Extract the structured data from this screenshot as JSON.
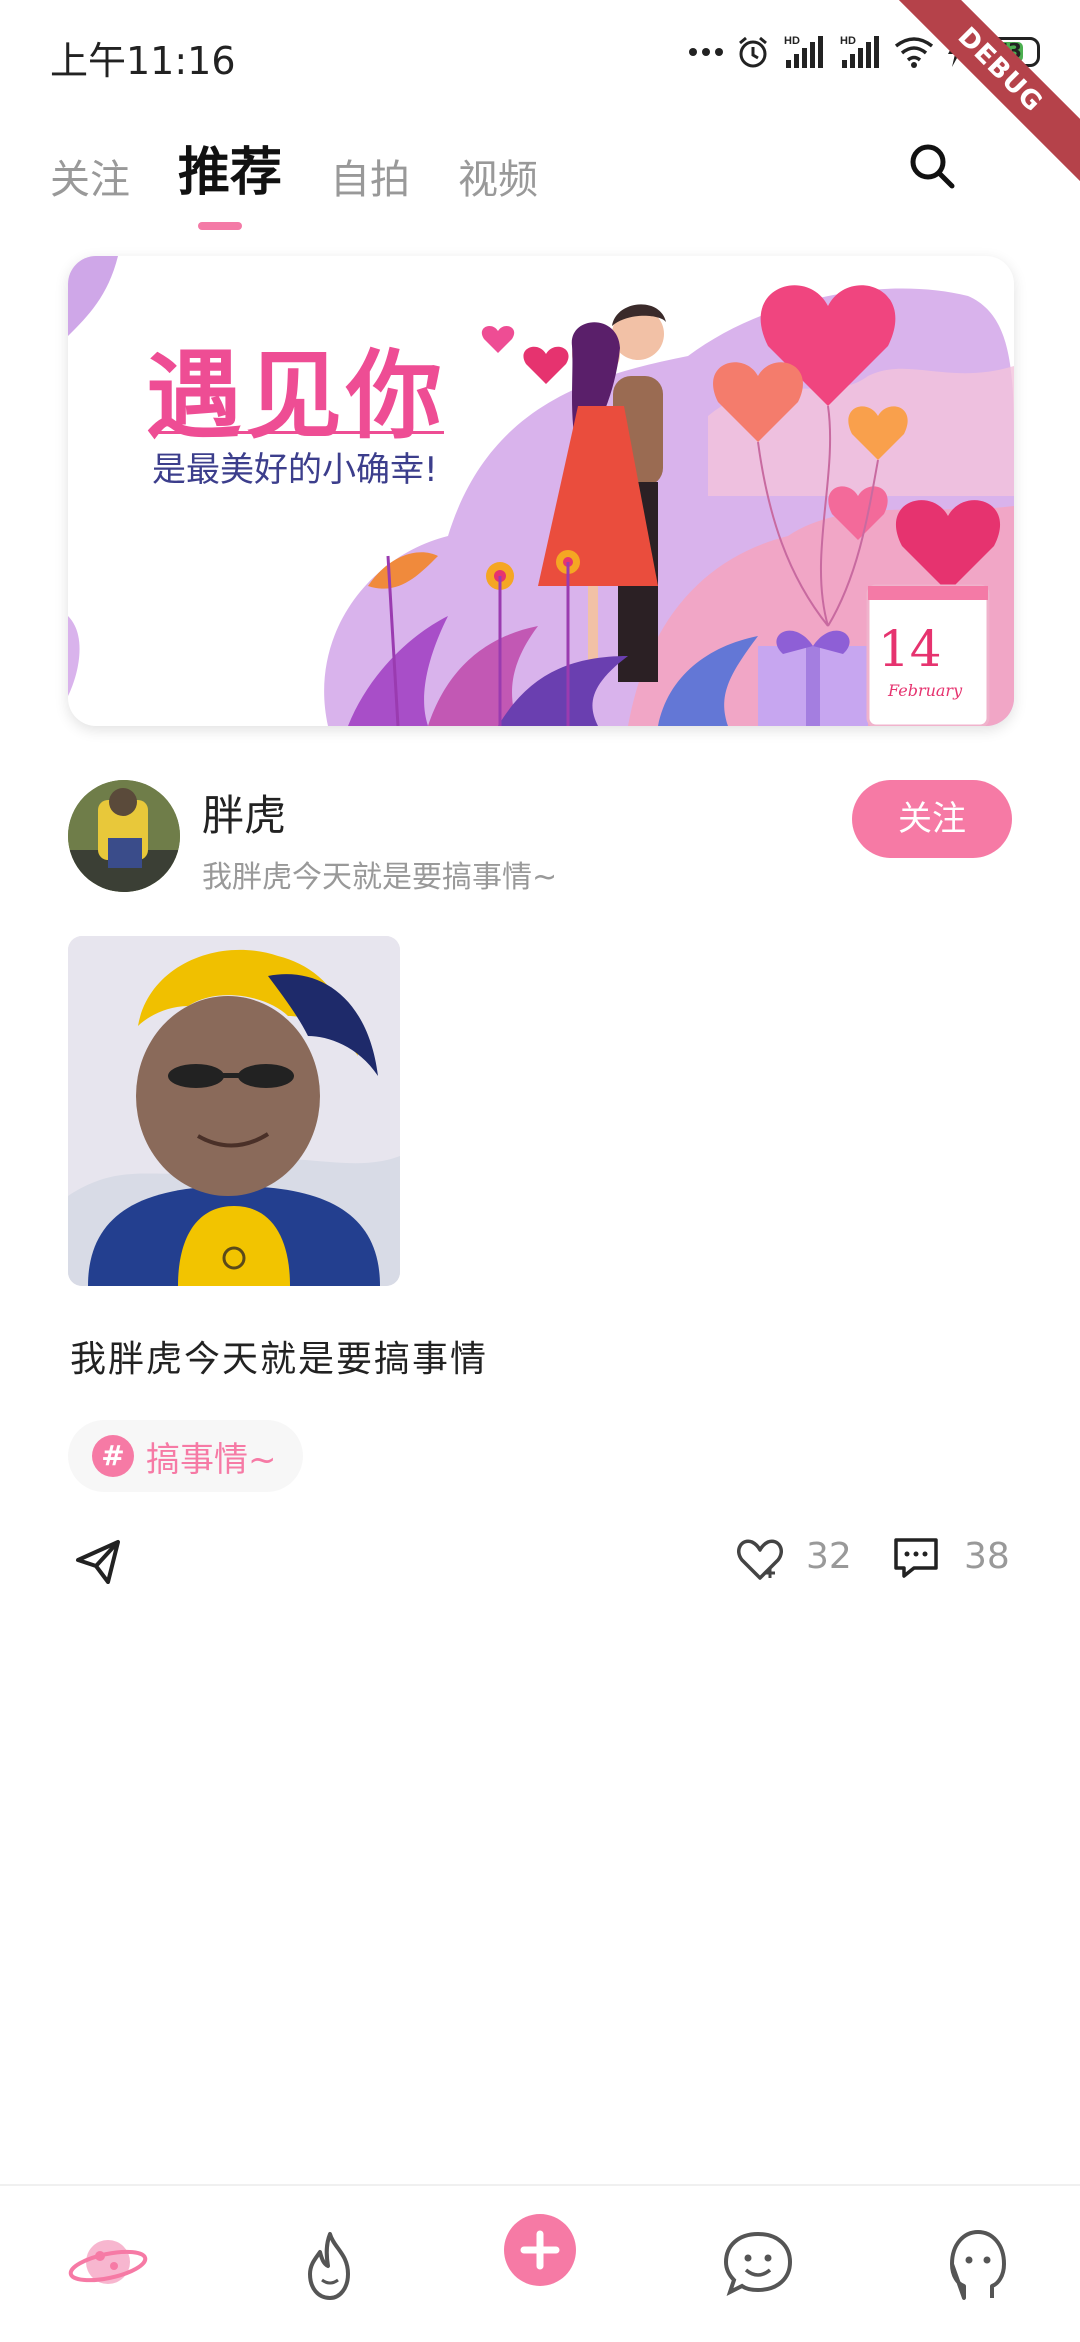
{
  "status_bar": {
    "time": "上午11:16",
    "battery_level": "73",
    "debug_label": "DEBUG"
  },
  "tabs": [
    {
      "label": "关注",
      "active": false
    },
    {
      "label": "推荐",
      "active": true
    },
    {
      "label": "自拍",
      "active": false
    },
    {
      "label": "视频",
      "active": false
    }
  ],
  "banner": {
    "title": "遇见你",
    "subtitle": "是最美好的小确幸!",
    "date_number": "14",
    "date_month": "February"
  },
  "post": {
    "author_name": "胖虎",
    "author_desc": "我胖虎今天就是要搞事情~",
    "follow_label": "关注",
    "text": "我胖虎今天就是要搞事情",
    "topic_symbol": "#",
    "topic": "搞事情~",
    "like_count": "32",
    "comment_count": "38"
  },
  "bottom_nav": [
    {
      "name": "planet-icon",
      "active": true
    },
    {
      "name": "flame-icon",
      "active": false
    },
    {
      "name": "add-icon",
      "active": false
    },
    {
      "name": "chat-icon",
      "active": false
    },
    {
      "name": "profile-icon",
      "active": false
    }
  ],
  "colors": {
    "accent": "#f67aa5",
    "text_primary": "#222222",
    "text_secondary": "#999999"
  }
}
